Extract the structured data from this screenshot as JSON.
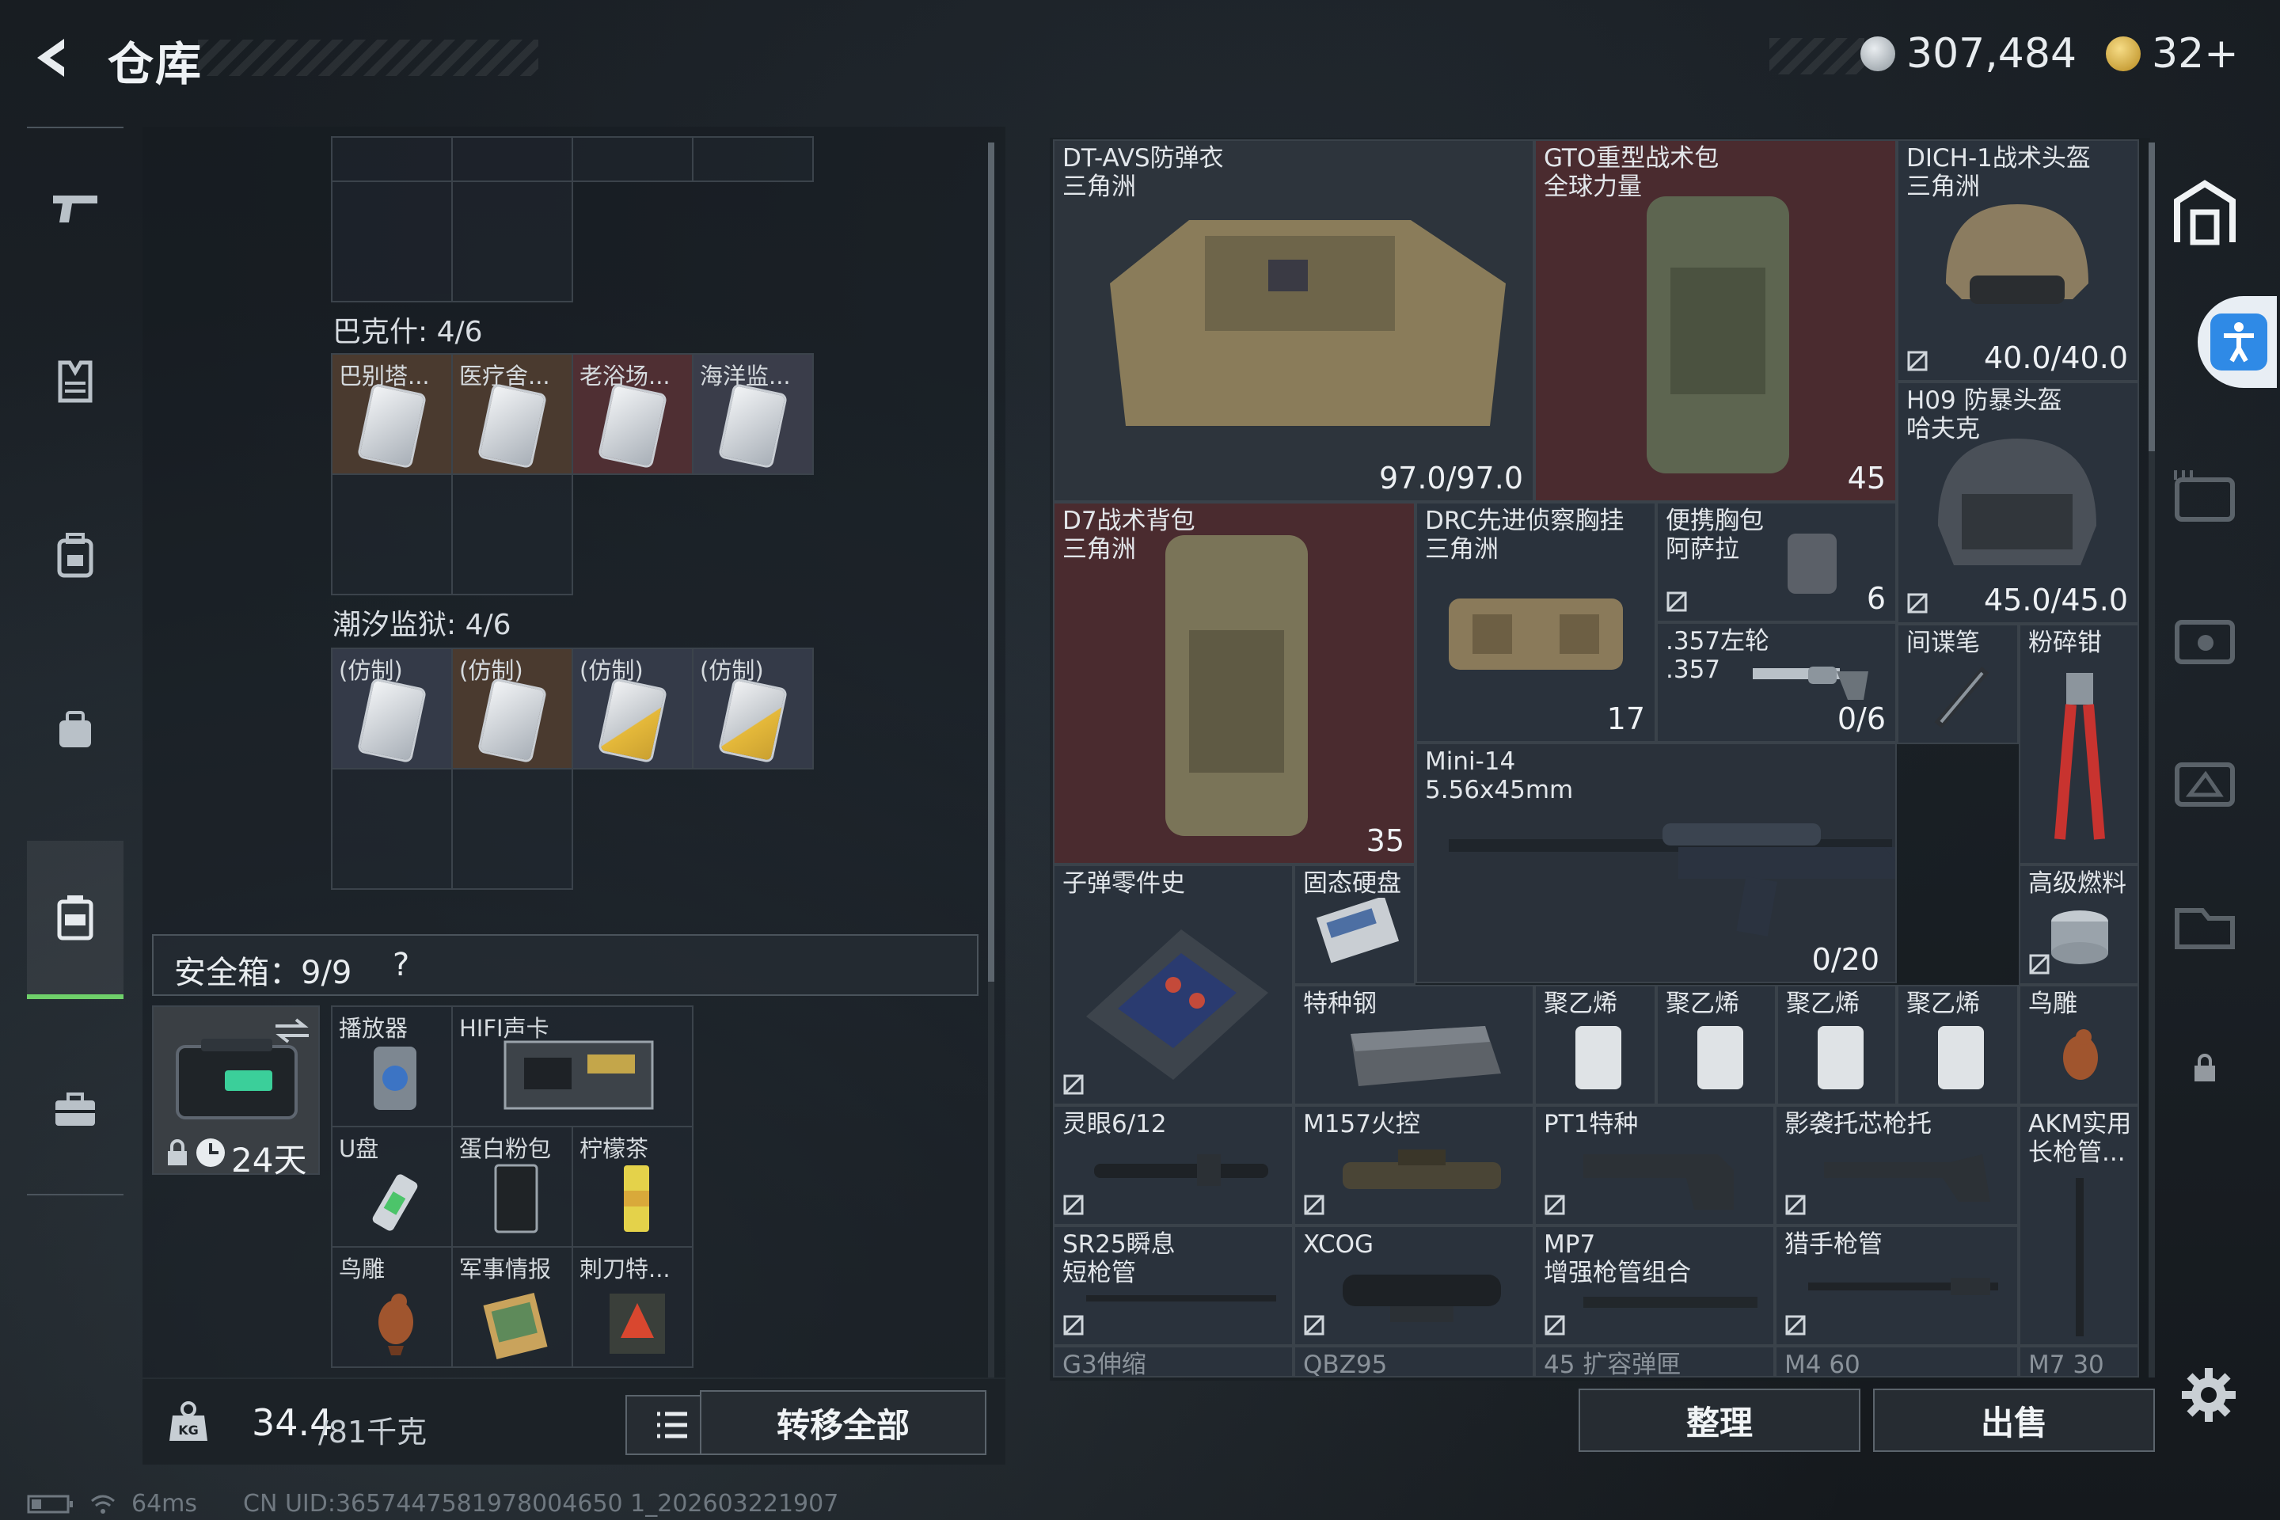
{
  "header": {
    "title": "仓库",
    "currency_a": "307,484",
    "currency_b": "32+"
  },
  "left_panel": {
    "sections": [
      {
        "title": "巴克什: 4/6",
        "items": [
          "巴别塔...",
          "医疗舍...",
          "老浴场...",
          "海洋监..."
        ]
      },
      {
        "title": "潮汐监狱: 4/6",
        "items": [
          "(仿制)",
          "(仿制)",
          "(仿制)",
          "(仿制)"
        ]
      }
    ],
    "safe_box": {
      "title": "安全箱：9/9",
      "help": "?",
      "timer": "24天",
      "items": [
        "播放器",
        "HIFI声卡",
        "U盘",
        "蛋白粉包",
        "柠檬茶",
        "鸟雕",
        "军事情报",
        "刺刀特..."
      ]
    },
    "weight": "34.4",
    "weight_cap": "/81千克",
    "transfer_all": "转移全部"
  },
  "grid": {
    "items": [
      {
        "name": "DT-AVS防弹衣\n三角洲",
        "value": "97.0/97.0"
      },
      {
        "name": "GTO重型战术包\n全球力量",
        "value": "45"
      },
      {
        "name": "DICH-1战术头盔\n三角洲",
        "value": "40.0/40.0"
      },
      {
        "name": "H09 防暴头盔\n哈夫克",
        "value": "45.0/45.0"
      },
      {
        "name": "D7战术背包\n三角洲",
        "value": "35"
      },
      {
        "name": "DRC先进侦察胸挂\n三角洲",
        "value": "17"
      },
      {
        "name": "便携胸包\n阿萨拉",
        "value": "6"
      },
      {
        "name": ".357左轮\n.357",
        "value": "0/6"
      },
      {
        "name": "间谍笔",
        "value": ""
      },
      {
        "name": "粉碎钳",
        "value": ""
      },
      {
        "name": "Mini-14\n5.56x45mm",
        "value": "0/20"
      },
      {
        "name": "子弹零件史",
        "value": ""
      },
      {
        "name": "固态硬盘",
        "value": ""
      },
      {
        "name": "高级燃料",
        "value": ""
      },
      {
        "name": "特种钢",
        "value": ""
      },
      {
        "name": "聚乙烯",
        "value": ""
      },
      {
        "name": "聚乙烯",
        "value": ""
      },
      {
        "name": "聚乙烯",
        "value": ""
      },
      {
        "name": "聚乙烯",
        "value": ""
      },
      {
        "name": "鸟雕",
        "value": ""
      },
      {
        "name": "灵眼6/12",
        "value": ""
      },
      {
        "name": "M157火控",
        "value": ""
      },
      {
        "name": "PT1特种",
        "value": ""
      },
      {
        "name": "影袭托芯枪托",
        "value": ""
      },
      {
        "name": "AKM实用\n长枪管...",
        "value": ""
      },
      {
        "name": "SR25瞬息\n短枪管",
        "value": ""
      },
      {
        "name": "XCOG",
        "value": ""
      },
      {
        "name": "MP7\n增强枪管组合",
        "value": ""
      },
      {
        "name": "猎手枪管",
        "value": ""
      },
      {
        "name": "G3伸缩",
        "value": ""
      },
      {
        "name": "QBZ95",
        "value": ""
      },
      {
        "name": "45 扩容弹匣",
        "value": ""
      },
      {
        "name": "M4 60",
        "value": ""
      },
      {
        "name": "M7 30",
        "value": ""
      }
    ],
    "sort_label": "整理",
    "sell_label": "出售"
  },
  "status": {
    "ping": "64ms",
    "uid": "CN UID:3657447581978004650 1_202603221907"
  },
  "colors": {
    "accent_green": "#6fd06a",
    "red_slot": "#4a2b2f",
    "slot": "#2a323c",
    "assist_blue": "#2f8ae6"
  }
}
